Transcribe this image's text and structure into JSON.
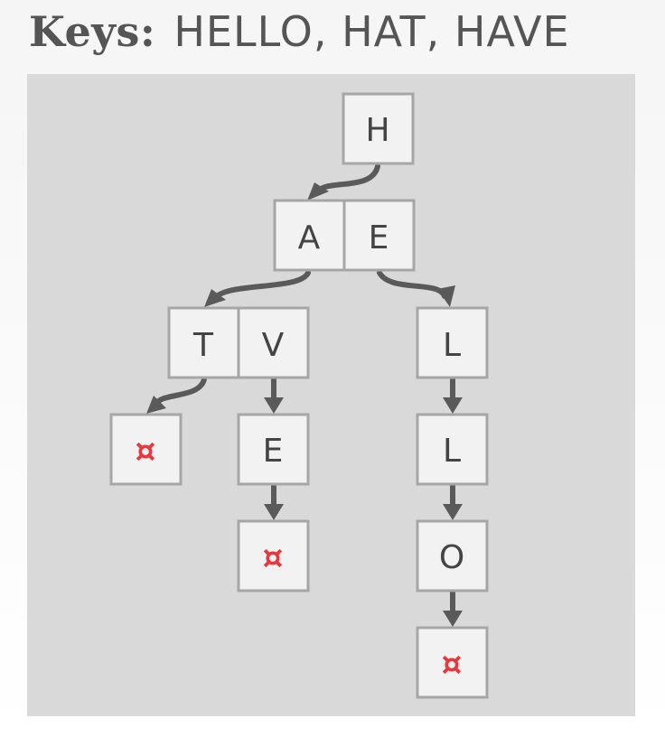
{
  "header": {
    "label": "Keys:",
    "keys": "HELLO, HAT, HAVE"
  },
  "colors": {
    "panel": "#d9d9d9",
    "box_fill": "#f2f2f2",
    "box_stroke": "#a6a6a6",
    "edge": "#5a5a5a",
    "terminal": "#e8383d"
  },
  "trie": {
    "root": {
      "chars": [
        "H"
      ]
    },
    "level1": {
      "chars": [
        "A",
        "E"
      ]
    },
    "node_a": {
      "chars": [
        "T",
        "V"
      ]
    },
    "node_e": {
      "chars": [
        "L"
      ]
    },
    "node_t": {
      "chars": [
        "¤"
      ]
    },
    "node_v": {
      "chars": [
        "E"
      ]
    },
    "node_ve": {
      "chars": [
        "¤"
      ]
    },
    "node_el": {
      "chars": [
        "L"
      ]
    },
    "node_ell": {
      "chars": [
        "O"
      ]
    },
    "node_ello": {
      "chars": [
        "¤"
      ]
    }
  }
}
